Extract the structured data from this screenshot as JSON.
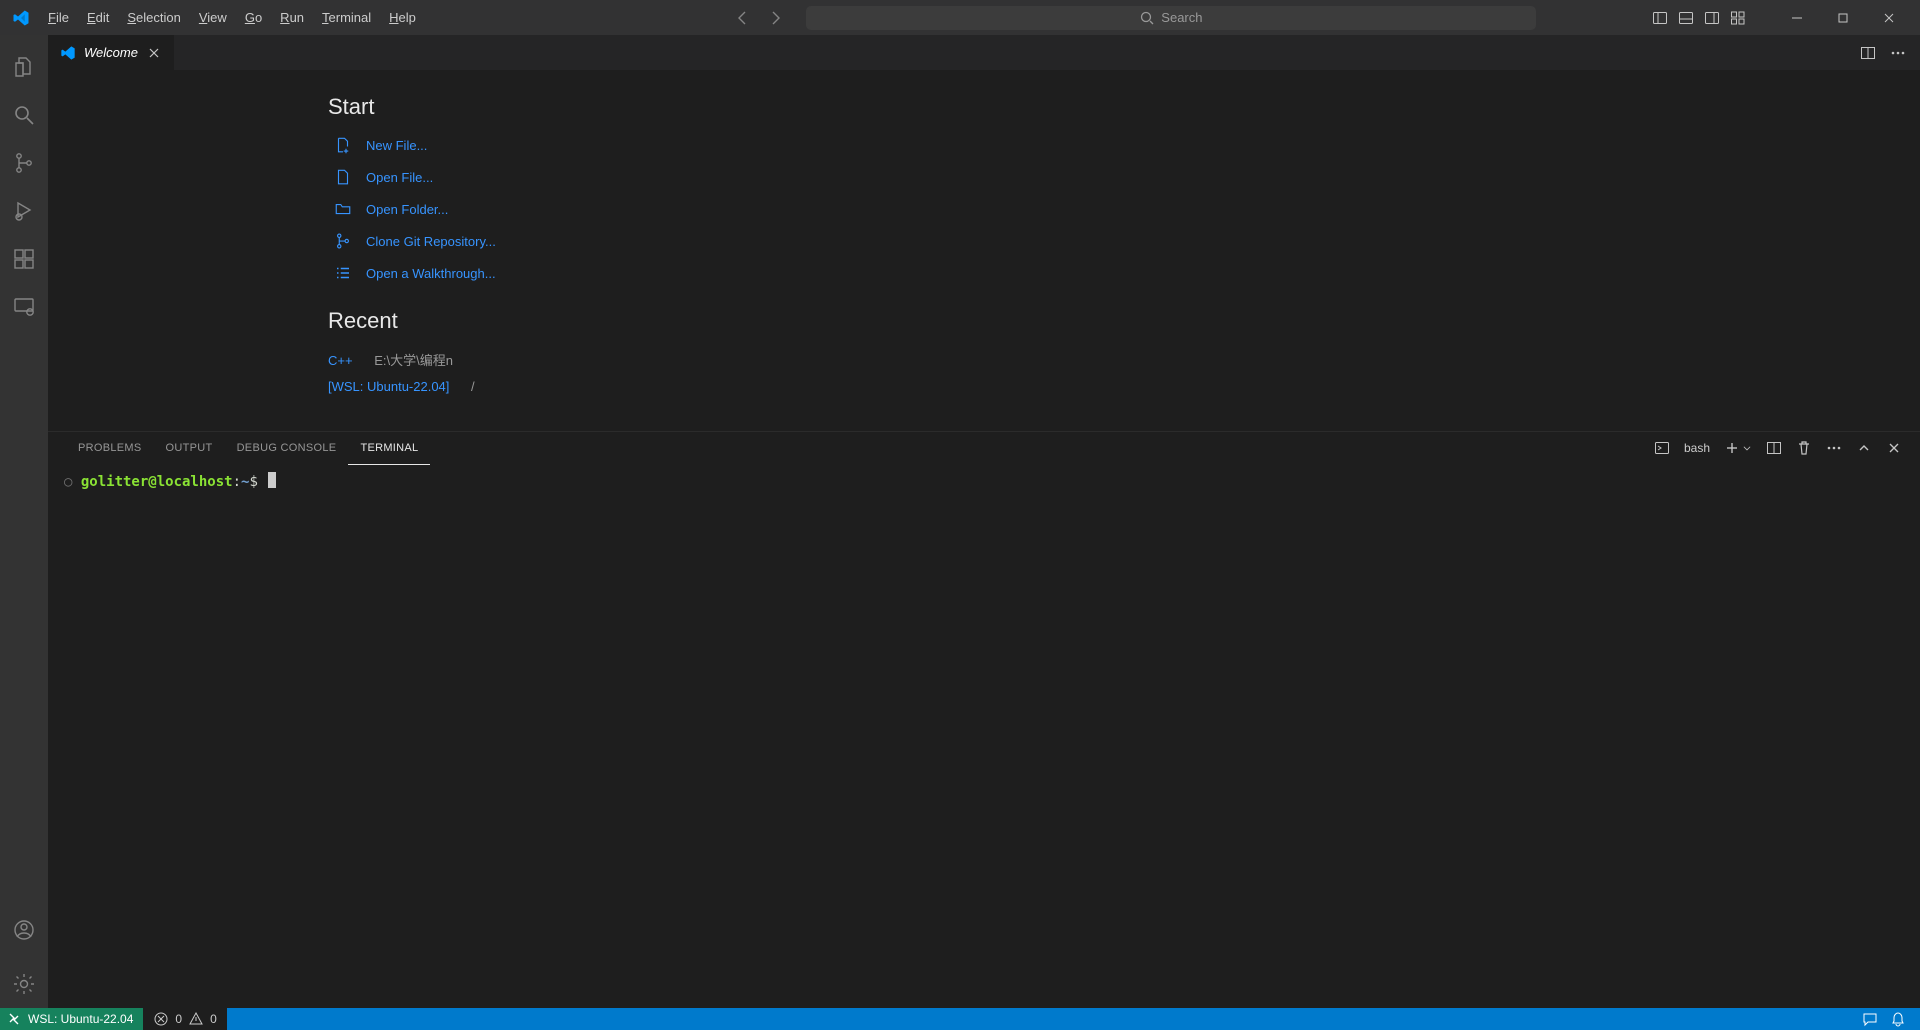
{
  "menu": {
    "file": "File",
    "edit": "Edit",
    "selection": "Selection",
    "view": "View",
    "go": "Go",
    "run": "Run",
    "terminal": "Terminal",
    "help": "Help"
  },
  "search": {
    "placeholder": "Search"
  },
  "tab": {
    "title": "Welcome"
  },
  "welcome": {
    "start_head": "Start",
    "start": {
      "new_file": "New File...",
      "open_file": "Open File...",
      "open_folder": "Open Folder...",
      "clone": "Clone Git Repository...",
      "walkthrough": "Open a Walkthrough..."
    },
    "recent_head": "Recent",
    "recent": [
      {
        "name": "C++",
        "path": "E:\\大学\\编程n"
      },
      {
        "name": "[WSL: Ubuntu-22.04]",
        "path": "/"
      }
    ]
  },
  "panel": {
    "tabs": {
      "problems": "PROBLEMS",
      "output": "OUTPUT",
      "debug": "DEBUG CONSOLE",
      "terminal": "TERMINAL"
    },
    "shell": "bash"
  },
  "terminal": {
    "prompt_user": "golitter@localhost",
    "prompt_path": "~",
    "prompt_symbol": "$"
  },
  "status": {
    "remote": "WSL: Ubuntu-22.04",
    "errors": "0",
    "warnings": "0"
  }
}
